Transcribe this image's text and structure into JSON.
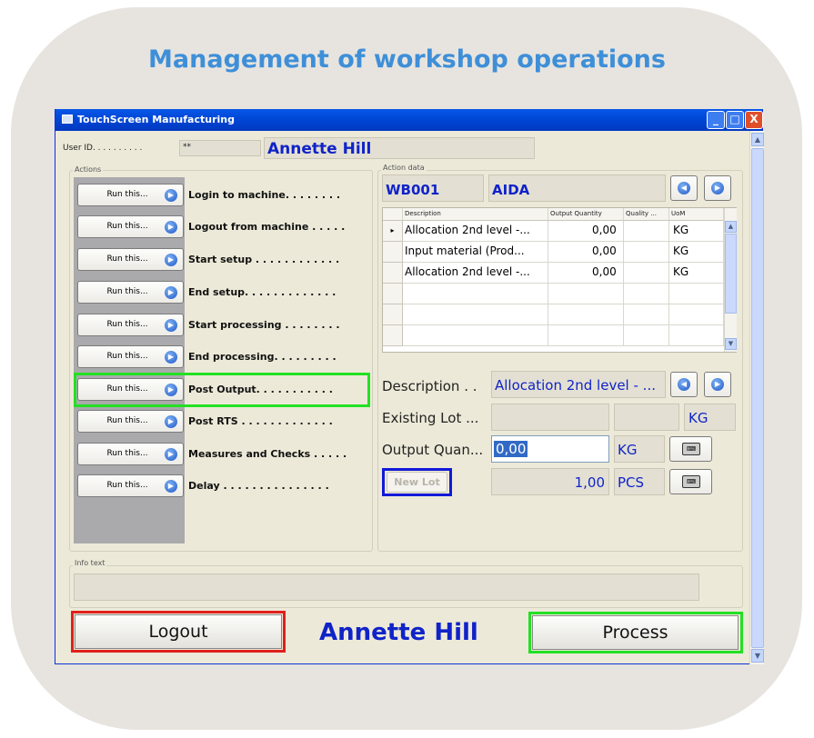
{
  "headline": "Management of workshop operations",
  "window": {
    "title": "TouchScreen Manufacturing",
    "min_glyph": "_",
    "max_glyph": "□",
    "close_glyph": "X"
  },
  "user": {
    "id_label": "User ID. . . . . . . . . .",
    "id_value": "**",
    "name": "Annette Hill"
  },
  "actions": {
    "group_label": "Actions",
    "items": [
      {
        "button": "Run this...",
        "label": "Login to machine. . . . . . . ."
      },
      {
        "button": "Run this...",
        "label": "Logout from machine . . . . ."
      },
      {
        "button": "Run this...",
        "label": "Start setup . . . . . . . . . . . ."
      },
      {
        "button": "Run this...",
        "label": "End setup. . . . . . . . . . . . ."
      },
      {
        "button": "Run this...",
        "label": "Start processing . . . . . . . ."
      },
      {
        "button": "Run this...",
        "label": "End processing. . . . . . . . ."
      },
      {
        "button": "Run this...",
        "label": "Post Output. . . . . . . . . . ."
      },
      {
        "button": "Run this...",
        "label": "Post RTS . . . . . . . . . . . . ."
      },
      {
        "button": "Run this...",
        "label": "Measures and Checks . . . . ."
      },
      {
        "button": "Run this...",
        "label": "Delay . . . . . . . . . . . . . . ."
      }
    ]
  },
  "action_data": {
    "group_label": "Action data",
    "code": "WB001",
    "machine": "AIDA",
    "grid": {
      "headers": [
        "Description",
        "Output Quantity",
        "Quality ...",
        "UoM"
      ],
      "rows": [
        {
          "description": "Allocation 2nd level -...",
          "qty": "0,00",
          "quality": "",
          "uom": "KG",
          "current": true
        },
        {
          "description": "Input material (Prod...",
          "qty": "0,00",
          "quality": "",
          "uom": "KG",
          "current": false
        },
        {
          "description": "Allocation 2nd level -...",
          "qty": "0,00",
          "quality": "",
          "uom": "KG",
          "current": false
        }
      ],
      "current_marker": "▸"
    },
    "description_label": "Description . .",
    "description_value": "Allocation 2nd level - ...",
    "existing_lot_label": "Existing Lot ...",
    "existing_lot_uom": "KG",
    "output_qty_label": "Output Quan...",
    "output_qty_value": "0,00",
    "output_qty_uom": "KG",
    "new_lot_button": "New Lot",
    "lot_qty_value": "1,00",
    "lot_qty_uom": "PCS"
  },
  "info": {
    "group_label": "Info text",
    "value": ""
  },
  "footer": {
    "logout_button": "Logout",
    "user_name": "Annette Hill",
    "process_button": "Process"
  },
  "colors": {
    "highlight_green": "#23e023",
    "highlight_red": "#e0201c",
    "highlight_blue": "#1219d8",
    "accent_blue": "#1023c9",
    "headline_blue": "#3e8fd8"
  }
}
